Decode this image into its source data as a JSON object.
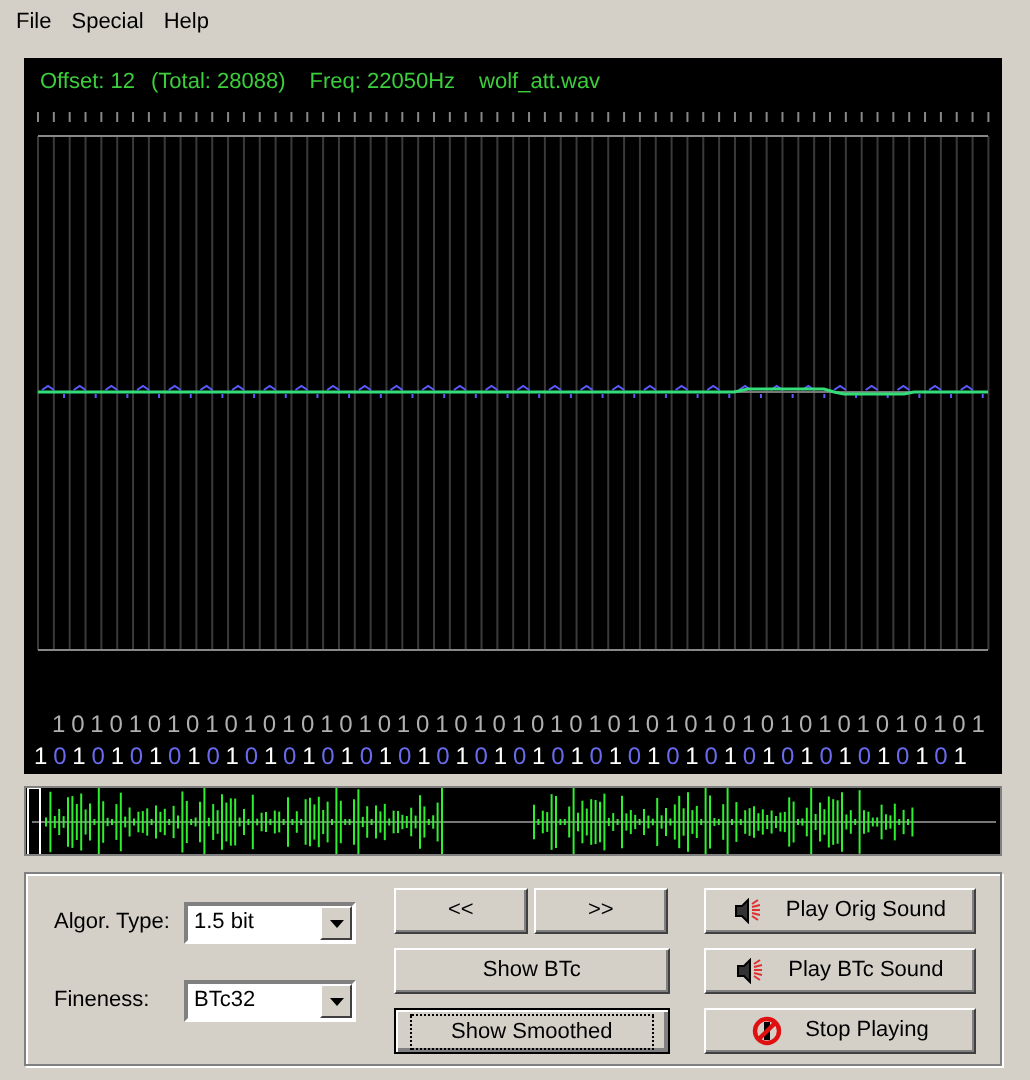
{
  "menu": [
    {
      "label": "File"
    },
    {
      "label": "Special"
    },
    {
      "label": "Help"
    }
  ],
  "display": {
    "status": {
      "offset": "Offset: 12",
      "total": "(Total: 28088)",
      "freq": "Freq: 22050Hz",
      "file": "wolf_att.wav"
    },
    "bit_rows": [
      {
        "digits": "1010101010101010101010101010101010101010101010101"
      },
      {
        "digits": "1010101010101010101010101010101010101010101010101"
      }
    ]
  },
  "controls": {
    "fields": [
      {
        "label": "Algor. Type:",
        "value": "1.5 bit"
      },
      {
        "label": "Fineness:",
        "value": "BTc32"
      }
    ],
    "nav_buttons": [
      {
        "label": "<<",
        "focused": false
      },
      {
        "label": ">>",
        "focused": false
      }
    ],
    "view_buttons": [
      {
        "label": "Show BTc",
        "focused": false
      },
      {
        "label": "Show Smoothed",
        "focused": true
      }
    ],
    "actions": [
      {
        "label": "Play Orig Sound",
        "kind": "speaker"
      },
      {
        "label": "Play BTc Sound",
        "kind": "speaker"
      },
      {
        "label": "Stop Playing",
        "kind": "stop"
      }
    ]
  }
}
